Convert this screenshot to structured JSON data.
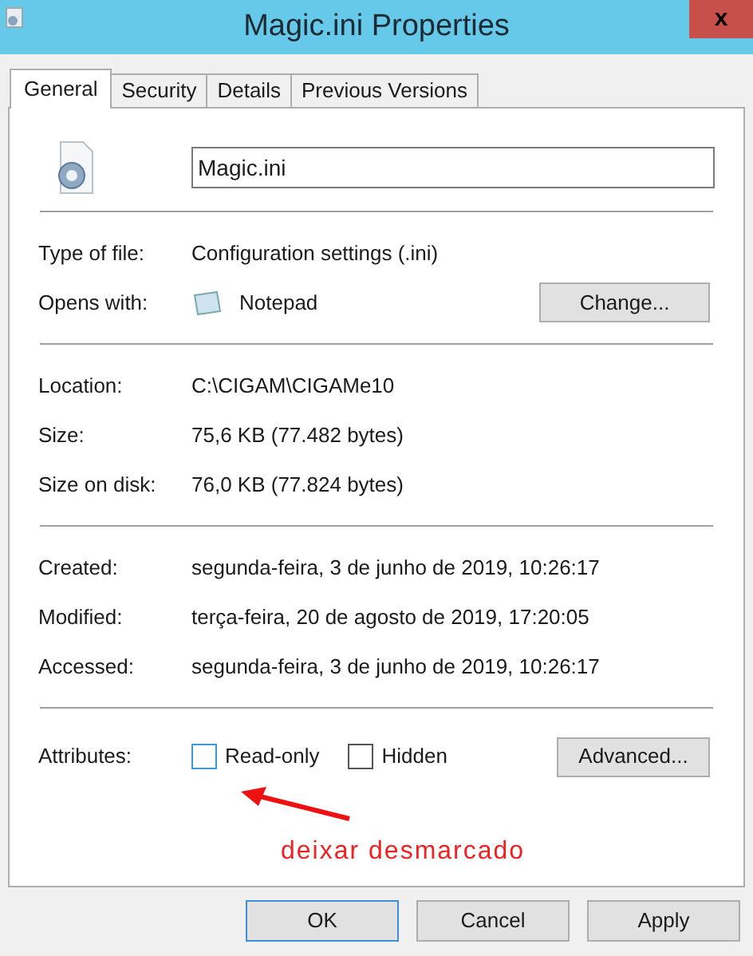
{
  "window": {
    "title": "Magic.ini Properties",
    "close": "x"
  },
  "tabs": [
    {
      "label": "General",
      "selected": true
    },
    {
      "label": "Security",
      "selected": false
    },
    {
      "label": "Details",
      "selected": false
    },
    {
      "label": "Previous Versions",
      "selected": false
    }
  ],
  "file_name": "Magic.ini",
  "groups": [
    [
      {
        "label": "Type of file:",
        "value": "Configuration settings (.ini)"
      },
      {
        "label": "Opens with:",
        "value": "Notepad",
        "kind": "app",
        "button": "Change..."
      }
    ],
    [
      {
        "label": "Location:",
        "value": "C:\\CIGAM\\CIGAMe10"
      },
      {
        "label": "Size:",
        "value": "75,6 KB (77.482 bytes)"
      },
      {
        "label": "Size on disk:",
        "value": "76,0 KB (77.824 bytes)"
      }
    ],
    [
      {
        "label": "Created:",
        "value": "segunda-feira, 3 de junho de 2019, 10:26:17"
      },
      {
        "label": "Modified:",
        "value": "terça-feira, 20 de agosto de 2019, 17:20:05"
      },
      {
        "label": "Accessed:",
        "value": "segunda-feira, 3 de junho de 2019, 10:26:17"
      }
    ]
  ],
  "attributes": {
    "label": "Attributes:",
    "options": [
      {
        "label": "Read-only",
        "checked": false
      },
      {
        "label": "Hidden",
        "checked": false
      }
    ],
    "button": "Advanced..."
  },
  "annotation": "deixar desmarcado",
  "buttons": [
    {
      "label": "OK",
      "default": true
    },
    {
      "label": "Cancel",
      "default": false
    },
    {
      "label": "Apply",
      "default": false
    }
  ]
}
